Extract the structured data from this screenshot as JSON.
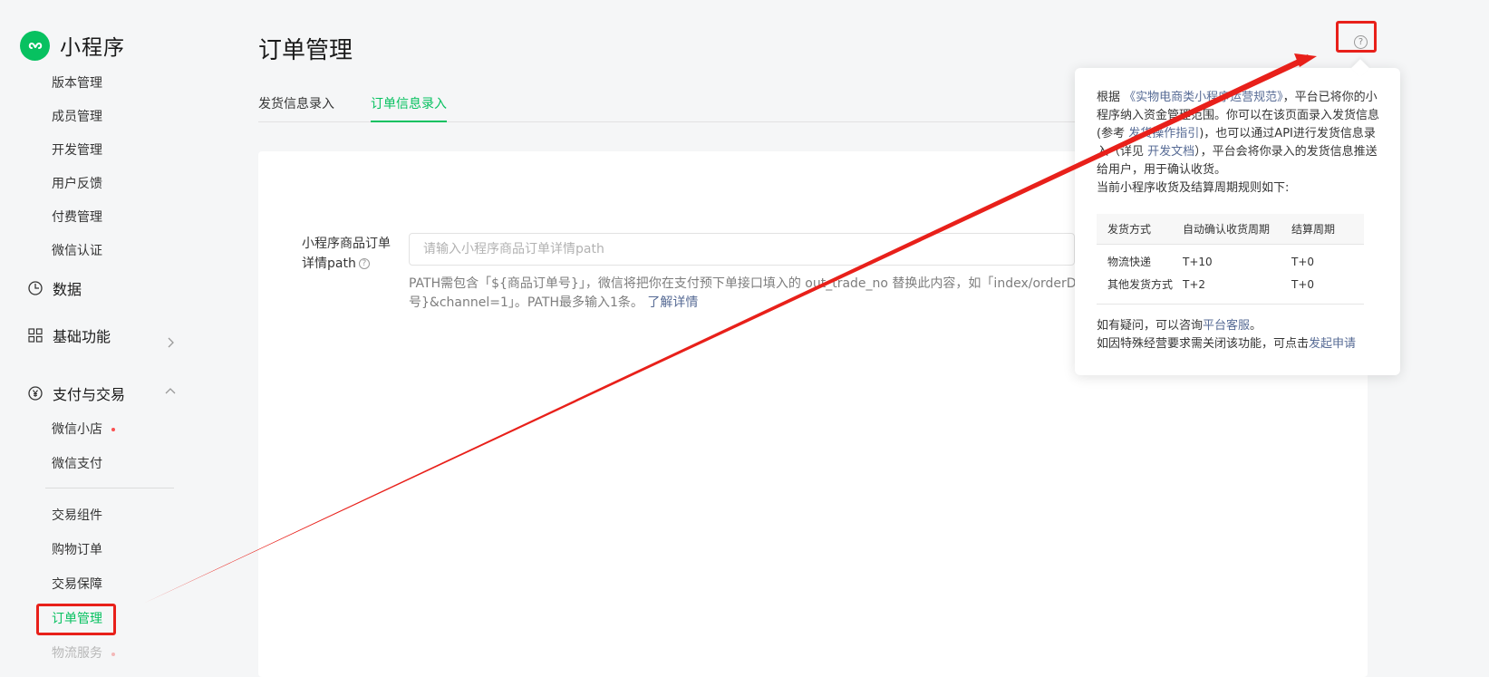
{
  "sidebar": {
    "logo_text": "小程序",
    "items_top": [
      "版本管理",
      "成员管理",
      "开发管理",
      "用户反馈",
      "付费管理",
      "微信认证"
    ],
    "group_data": "数据",
    "group_basic": "基础功能",
    "group_pay": "支付与交易",
    "pay_items": [
      "微信小店",
      "微信支付"
    ],
    "trade_items": [
      "交易组件",
      "购物订单",
      "交易保障",
      "订单管理",
      "物流服务"
    ]
  },
  "header": {
    "title": "订单管理"
  },
  "tabs": [
    {
      "label": "发货信息录入",
      "active": false
    },
    {
      "label": "订单信息录入",
      "active": true
    }
  ],
  "form": {
    "label": "小程序商品订单详情path",
    "placeholder": "请输入小程序商品订单详情path",
    "hint_line1": "PATH需包含「${商品订单号}」，微信将把你在支付预下单接口填入的 out_trade_no 替换此内容，如「index/orderD",
    "hint_line2": "号}&channel=1」。PATH最多输入1条。",
    "hint_link": "了解详情"
  },
  "help_icon": "question-circle-icon",
  "popover": {
    "p1_a": "根据",
    "p1_link": "《实物电商类小程序运营规范》",
    "p1_b": "，平台已将你的小程序纳入资金管理范围。你可以在该页面录入发货信息(参考",
    "p1_link2": "发货操作指引",
    "p1_c": ")，也可以通过API进行发货信息录入（详见",
    "p1_link3": "开发文档",
    "p1_d": "），平台会将你录入的发货信息推送给用户，用于确认收货。",
    "p2": "当前小程序收货及结算周期规则如下:",
    "table_headers": [
      "发货方式",
      "自动确认收货周期",
      "结算周期"
    ],
    "table_rows": [
      [
        "物流快递",
        "T+10",
        "T+0"
      ],
      [
        "其他发货方式",
        "T+2",
        "T+0"
      ]
    ],
    "foot1_a": "如有疑问，可以咨询",
    "foot1_link": "平台客服",
    "foot1_b": "。",
    "foot2_a": "如因特殊经营要求需关闭该功能，可点击",
    "foot2_link": "发起申请"
  },
  "colors": {
    "accent": "#07c160",
    "annotation": "#e8201a",
    "link": "#576b95"
  }
}
